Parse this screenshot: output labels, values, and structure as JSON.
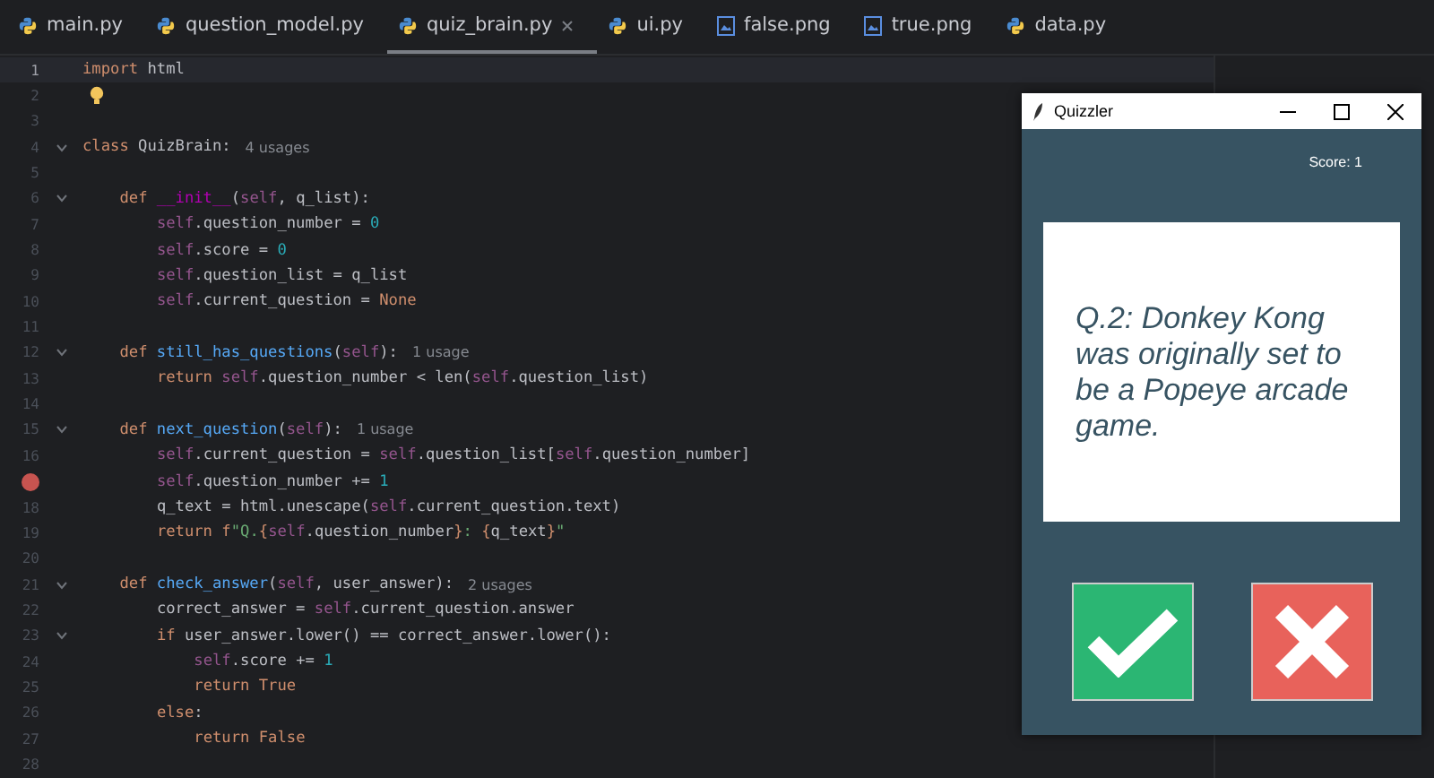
{
  "tabs": [
    {
      "label": "main.py",
      "kind": "python",
      "selected": false
    },
    {
      "label": "question_model.py",
      "kind": "python",
      "selected": false
    },
    {
      "label": "quiz_brain.py",
      "kind": "python",
      "selected": true
    },
    {
      "label": "ui.py",
      "kind": "python",
      "selected": false
    },
    {
      "label": "false.png",
      "kind": "image",
      "selected": false
    },
    {
      "label": "true.png",
      "kind": "image",
      "selected": false
    },
    {
      "label": "data.py",
      "kind": "python",
      "selected": false
    }
  ],
  "lines": [
    {
      "kind": "code",
      "number": "1",
      "current": true,
      "fold": false,
      "tokens": [
        {
          "kind": "kw",
          "text": "import"
        },
        {
          "kind": "plain",
          "text": " html"
        }
      ]
    },
    {
      "kind": "bulb",
      "number": "2",
      "current": false,
      "fold": false
    },
    {
      "kind": "code",
      "number": "3",
      "current": false,
      "fold": false
    },
    {
      "kind": "code",
      "number": "4",
      "current": false,
      "fold": true,
      "tokens": [
        {
          "kind": "kw",
          "text": "class"
        },
        {
          "kind": "plain",
          "text": " QuizBrain:"
        }
      ],
      "hint": "4 usages"
    },
    {
      "kind": "code",
      "number": "5",
      "current": false,
      "fold": false
    },
    {
      "kind": "code",
      "number": "6",
      "current": false,
      "fold": true,
      "tokens": [
        {
          "kind": "kw",
          "text": "    def"
        },
        {
          "kind": "magic",
          "text": " __init__"
        },
        {
          "kind": "plain",
          "text": "("
        },
        {
          "kind": "self",
          "text": "self"
        },
        {
          "kind": "plain",
          "text": ", q_list):"
        }
      ]
    },
    {
      "kind": "code",
      "number": "7",
      "current": false,
      "fold": false,
      "tokens": [
        {
          "kind": "self",
          "text": "        self"
        },
        {
          "kind": "plain",
          "text": ".question_number = "
        },
        {
          "kind": "num",
          "text": "0"
        }
      ]
    },
    {
      "kind": "code",
      "number": "8",
      "current": false,
      "fold": false,
      "tokens": [
        {
          "kind": "self",
          "text": "        self"
        },
        {
          "kind": "plain",
          "text": ".score = "
        },
        {
          "kind": "num",
          "text": "0"
        }
      ]
    },
    {
      "kind": "code",
      "number": "9",
      "current": false,
      "fold": false,
      "tokens": [
        {
          "kind": "self",
          "text": "        self"
        },
        {
          "kind": "plain",
          "text": ".question_list = q_list"
        }
      ]
    },
    {
      "kind": "code",
      "number": "10",
      "current": false,
      "fold": false,
      "tokens": [
        {
          "kind": "self",
          "text": "        self"
        },
        {
          "kind": "plain",
          "text": ".current_question = "
        },
        {
          "kind": "kw",
          "text": "None"
        }
      ]
    },
    {
      "kind": "code",
      "number": "11",
      "current": false,
      "fold": false
    },
    {
      "kind": "code",
      "number": "12",
      "current": false,
      "fold": true,
      "tokens": [
        {
          "kind": "kw",
          "text": "    def"
        },
        {
          "kind": "fn",
          "text": " still_has_questions"
        },
        {
          "kind": "plain",
          "text": "("
        },
        {
          "kind": "self",
          "text": "self"
        },
        {
          "kind": "plain",
          "text": "):"
        }
      ],
      "hint": "1 usage"
    },
    {
      "kind": "code",
      "number": "13",
      "current": false,
      "fold": false,
      "tokens": [
        {
          "kind": "kw",
          "text": "        return"
        },
        {
          "kind": "self",
          "text": " self"
        },
        {
          "kind": "plain",
          "text": ".question_number < len("
        },
        {
          "kind": "self",
          "text": "self"
        },
        {
          "kind": "plain",
          "text": ".question_list)"
        }
      ]
    },
    {
      "kind": "code",
      "number": "14",
      "current": false,
      "fold": false
    },
    {
      "kind": "code",
      "number": "15",
      "current": false,
      "fold": true,
      "tokens": [
        {
          "kind": "kw",
          "text": "    def"
        },
        {
          "kind": "fn",
          "text": " next_question"
        },
        {
          "kind": "plain",
          "text": "("
        },
        {
          "kind": "self",
          "text": "self"
        },
        {
          "kind": "plain",
          "text": "):"
        }
      ],
      "hint": "1 usage"
    },
    {
      "kind": "code",
      "number": "16",
      "current": false,
      "fold": false,
      "tokens": [
        {
          "kind": "self",
          "text": "        self"
        },
        {
          "kind": "plain",
          "text": ".current_question = "
        },
        {
          "kind": "self",
          "text": "self"
        },
        {
          "kind": "plain",
          "text": ".question_list["
        },
        {
          "kind": "self",
          "text": "self"
        },
        {
          "kind": "plain",
          "text": ".question_number]"
        }
      ]
    },
    {
      "kind": "breakpoint",
      "current": false,
      "fold": false,
      "tokens": [
        {
          "kind": "self",
          "text": "        self"
        },
        {
          "kind": "plain",
          "text": ".question_number += "
        },
        {
          "kind": "num",
          "text": "1"
        }
      ]
    },
    {
      "kind": "code",
      "number": "18",
      "current": false,
      "fold": false,
      "tokens": [
        {
          "kind": "plain",
          "text": "        q_text = html.unescape("
        },
        {
          "kind": "self",
          "text": "self"
        },
        {
          "kind": "plain",
          "text": ".current_question.text)"
        }
      ]
    },
    {
      "kind": "code",
      "number": "19",
      "current": false,
      "fold": false,
      "tokens": [
        {
          "kind": "kw",
          "text": "        return f"
        },
        {
          "kind": "str",
          "text": "\"Q."
        },
        {
          "kind": "kw",
          "text": "{"
        },
        {
          "kind": "self",
          "text": "self"
        },
        {
          "kind": "plain",
          "text": ".question_number"
        },
        {
          "kind": "kw",
          "text": "}"
        },
        {
          "kind": "str",
          "text": ": "
        },
        {
          "kind": "kw",
          "text": "{"
        },
        {
          "kind": "plain",
          "text": "q_text"
        },
        {
          "kind": "kw",
          "text": "}"
        },
        {
          "kind": "str",
          "text": "\""
        }
      ]
    },
    {
      "kind": "code",
      "number": "20",
      "current": false,
      "fold": false
    },
    {
      "kind": "code",
      "number": "21",
      "current": false,
      "fold": true,
      "tokens": [
        {
          "kind": "kw",
          "text": "    def"
        },
        {
          "kind": "fn",
          "text": " check_answer"
        },
        {
          "kind": "plain",
          "text": "("
        },
        {
          "kind": "self",
          "text": "self"
        },
        {
          "kind": "plain",
          "text": ", user_answer):"
        }
      ],
      "hint": "2 usages"
    },
    {
      "kind": "code",
      "number": "22",
      "current": false,
      "fold": false,
      "tokens": [
        {
          "kind": "plain",
          "text": "        correct_answer = "
        },
        {
          "kind": "self",
          "text": "self"
        },
        {
          "kind": "plain",
          "text": ".current_question.answer"
        }
      ]
    },
    {
      "kind": "code",
      "number": "23",
      "current": false,
      "fold": true,
      "tokens": [
        {
          "kind": "kw",
          "text": "        if"
        },
        {
          "kind": "plain",
          "text": " user_answer.lower() == correct_answer.lower():"
        }
      ]
    },
    {
      "kind": "code",
      "number": "24",
      "current": false,
      "fold": false,
      "tokens": [
        {
          "kind": "self",
          "text": "            self"
        },
        {
          "kind": "plain",
          "text": ".score += "
        },
        {
          "kind": "num",
          "text": "1"
        }
      ]
    },
    {
      "kind": "code",
      "number": "25",
      "current": false,
      "fold": false,
      "tokens": [
        {
          "kind": "kw",
          "text": "            return True"
        }
      ]
    },
    {
      "kind": "code",
      "number": "26",
      "current": false,
      "fold": false,
      "tokens": [
        {
          "kind": "kw",
          "text": "        else"
        },
        {
          "kind": "plain",
          "text": ":"
        }
      ]
    },
    {
      "kind": "code",
      "number": "27",
      "current": false,
      "fold": false,
      "tokens": [
        {
          "kind": "kw",
          "text": "            return False"
        }
      ]
    },
    {
      "kind": "code",
      "number": "28",
      "current": false,
      "fold": false
    }
  ],
  "quiz_window": {
    "title": "Quizzler",
    "score": "Score: 1",
    "question": "Q.2: Donkey Kong was originally set to be a Popeye arcade game.",
    "buttons": [
      {
        "kind": "true"
      },
      {
        "kind": "false"
      }
    ]
  }
}
